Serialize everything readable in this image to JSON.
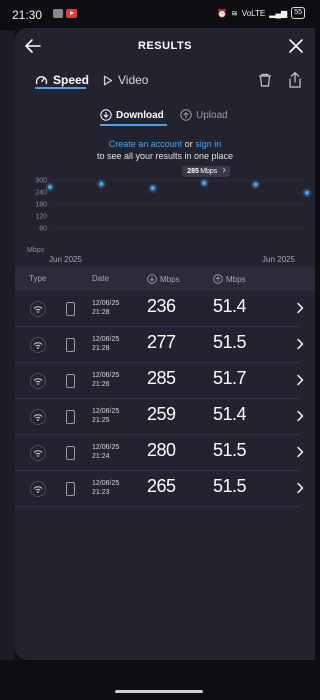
{
  "status": {
    "time": "21:30",
    "network": "VoLTE",
    "battery": "55"
  },
  "header": {
    "title": "RESULTS"
  },
  "tabs": {
    "speed": "Speed",
    "video": "Video"
  },
  "subtabs": {
    "download": "Download",
    "upload": "Upload"
  },
  "account": {
    "create": "Create an account",
    "or": " or ",
    "signin": "sign in",
    "line2": "to see all your results in one place"
  },
  "chart_data": {
    "type": "scatter",
    "yticks": [
      "300",
      "240",
      "180",
      "120",
      "60"
    ],
    "yunit": "Mbps",
    "x": [
      "Jun 2025",
      "",
      "",
      "",
      "",
      "Jun 2025"
    ],
    "values": [
      265,
      280,
      259,
      285,
      277,
      236
    ],
    "ylim": [
      0,
      300
    ],
    "tooltip": {
      "value": "285",
      "unit": "Mbps"
    },
    "xlabel_left": "Jun 2025",
    "xlabel_right": "Jun 2025"
  },
  "table": {
    "headers": {
      "type": "Type",
      "date": "Date",
      "download": "Mbps",
      "upload": "Mbps"
    },
    "rows": [
      {
        "date": "12/06/25",
        "time": "21:28",
        "download": "236",
        "upload": "51.4"
      },
      {
        "date": "12/06/25",
        "time": "21:28",
        "download": "277",
        "upload": "51.5"
      },
      {
        "date": "12/06/25",
        "time": "21:26",
        "download": "285",
        "upload": "51.7"
      },
      {
        "date": "12/06/25",
        "time": "21:25",
        "download": "259",
        "upload": "51.4"
      },
      {
        "date": "12/06/25",
        "time": "21:24",
        "download": "280",
        "upload": "51.5"
      },
      {
        "date": "12/06/25",
        "time": "21:23",
        "download": "265",
        "upload": "51.5"
      }
    ]
  },
  "colors": {
    "accent": "#4aa3f0",
    "sheet": "#23232f",
    "background": "#0d0d12"
  }
}
